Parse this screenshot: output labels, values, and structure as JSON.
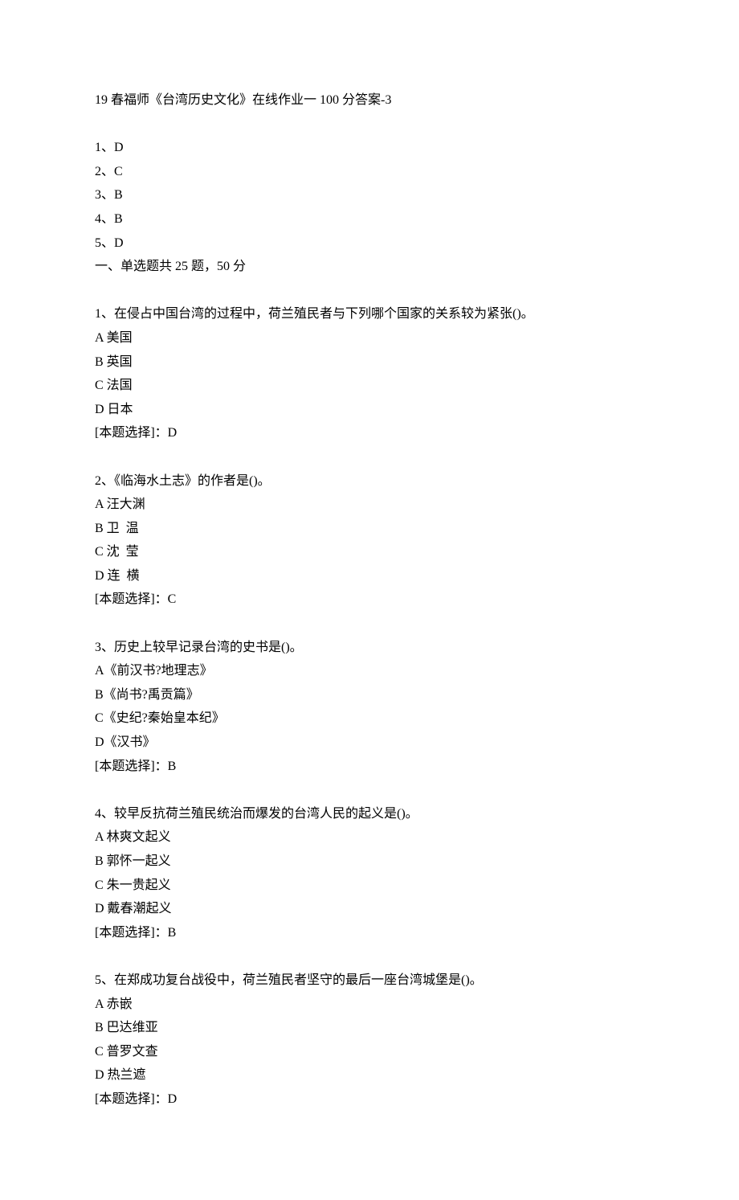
{
  "title": "19 春福师《台湾历史文化》在线作业一 100 分答案-3",
  "answer_key": [
    "1、D",
    "2、C",
    "3、B",
    "4、B",
    "5、D"
  ],
  "section_header": "一、单选题共 25 题，50 分",
  "questions": [
    {
      "prompt": "1、在侵占中国台湾的过程中，荷兰殖民者与下列哪个国家的关系较为紧张()。",
      "options": [
        "A 美国",
        "B 英国",
        "C 法国",
        "D 日本"
      ],
      "answer": "[本题选择]：D"
    },
    {
      "prompt": "2、《临海水土志》的作者是()。",
      "options": [
        "A 汪大渊",
        "B 卫  温",
        "C 沈  莹",
        "D 连  横"
      ],
      "answer": "[本题选择]：C"
    },
    {
      "prompt": "3、历史上较早记录台湾的史书是()。",
      "options": [
        "A《前汉书?地理志》",
        "B《尚书?禹贡篇》",
        "C《史纪?秦始皇本纪》",
        "D《汉书》"
      ],
      "answer": "[本题选择]：B"
    },
    {
      "prompt": "4、较早反抗荷兰殖民统治而爆发的台湾人民的起义是()。",
      "options": [
        "A 林爽文起义",
        "B 郭怀一起义",
        "C 朱一贵起义",
        "D 戴春潮起义"
      ],
      "answer": "[本题选择]：B"
    },
    {
      "prompt": "5、在郑成功复台战役中，荷兰殖民者坚守的最后一座台湾城堡是()。",
      "options": [
        "A 赤嵌",
        "B 巴达维亚",
        "C 普罗文查",
        "D 热兰遮"
      ],
      "answer": "[本题选择]：D"
    }
  ]
}
